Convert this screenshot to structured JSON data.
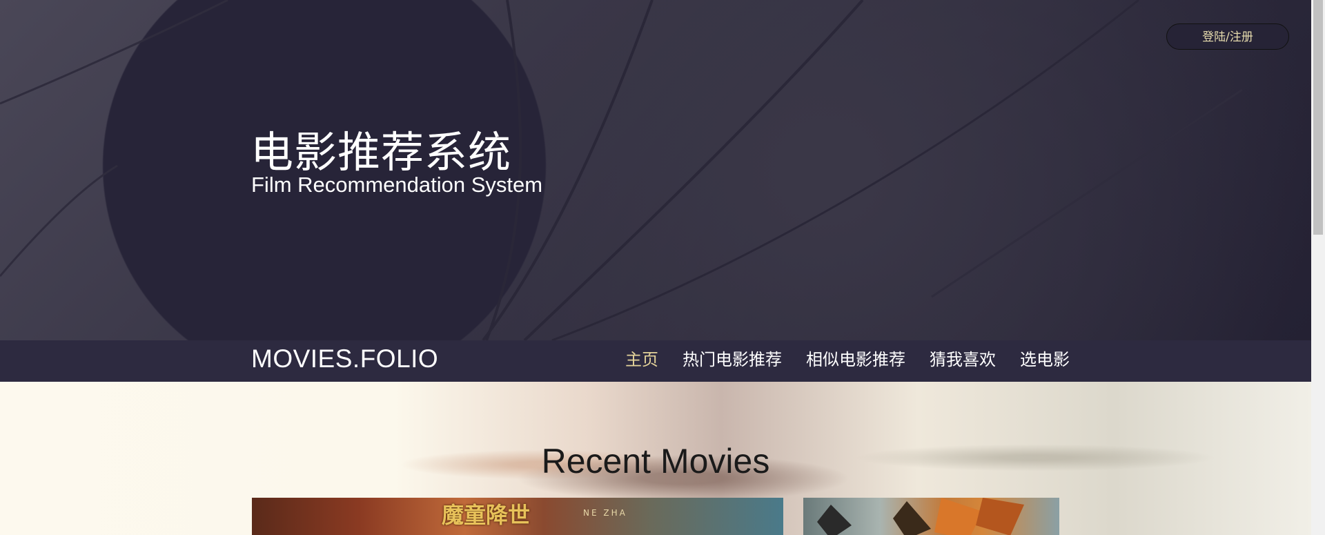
{
  "header": {
    "login_label": "登陆/注册",
    "title": "电影推荐系统",
    "subtitle": "Film Recommendation System"
  },
  "nav": {
    "brand": "MOVIES.FOLIO",
    "items": [
      {
        "label": "主页",
        "active": true
      },
      {
        "label": "热门电影推荐",
        "active": false
      },
      {
        "label": "相似电影推荐",
        "active": false
      },
      {
        "label": "猜我喜欢",
        "active": false
      },
      {
        "label": "选电影",
        "active": false
      }
    ]
  },
  "main": {
    "section_title": "Recent Movies",
    "movies": [
      {
        "poster_title": "魔童降世",
        "poster_subtitle": "NE ZHA"
      },
      {
        "poster_title": "",
        "poster_subtitle": ""
      }
    ]
  },
  "colors": {
    "hero_bg": "#262336",
    "nav_bg": "#2d2a40",
    "nav_active": "#e4d39a",
    "login_text": "#e7dcae"
  }
}
